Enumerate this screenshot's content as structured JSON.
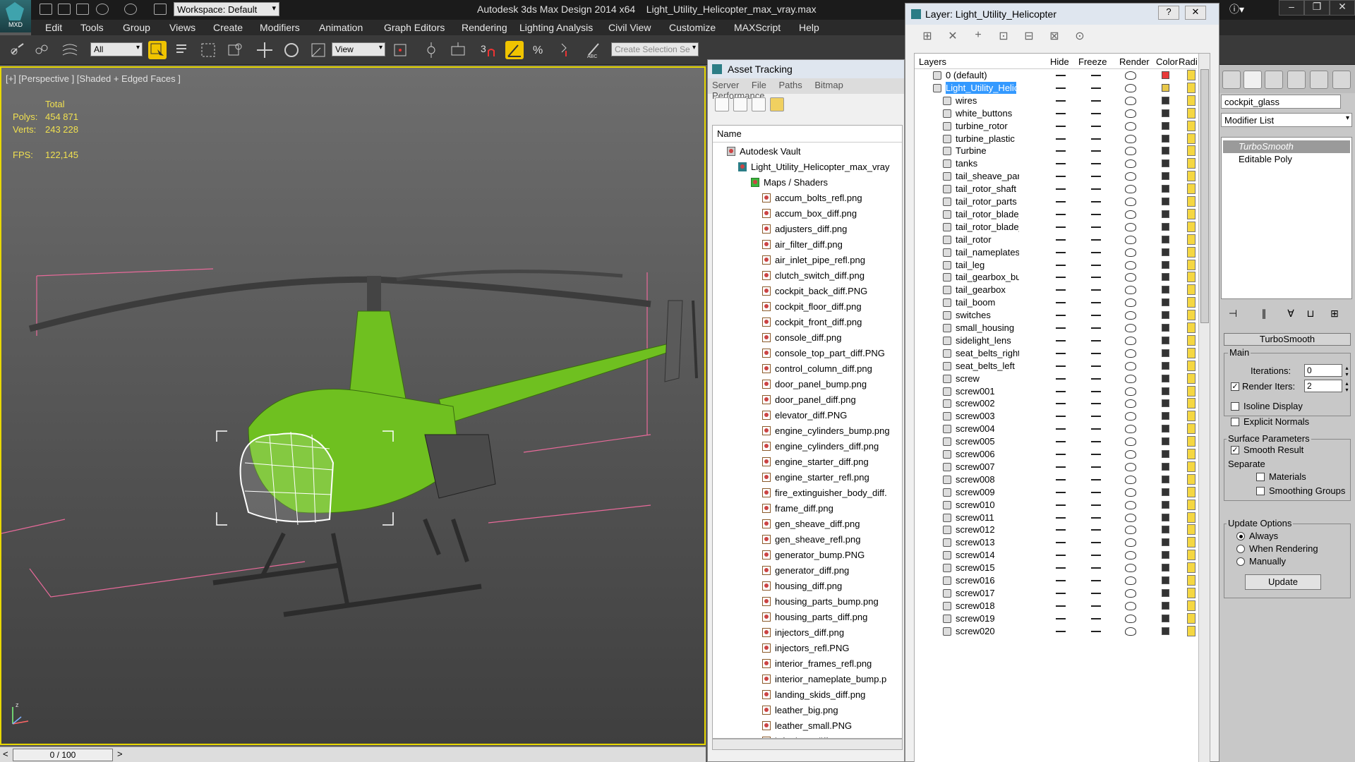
{
  "titlebar": {
    "workspace": "Workspace: Default",
    "app_name": "Autodesk 3ds Max Design 2014 x64",
    "file_name": "Light_Utility_Helicopter_max_vray.max",
    "logo_label": "MXD"
  },
  "menu": [
    "Edit",
    "Tools",
    "Group",
    "Views",
    "Create",
    "Modifiers",
    "Animation",
    "Graph Editors",
    "Rendering",
    "Lighting Analysis",
    "Civil View",
    "Customize",
    "MAXScript",
    "Help"
  ],
  "toolbar": {
    "filter": "All",
    "ref_coord": "View",
    "selection_set_placeholder": "Create Selection Se"
  },
  "viewport": {
    "label": "[+] [Perspective ] [Shaded + Edged Faces ]",
    "total_label": "Total",
    "polys_label": "Polys:",
    "polys_value": "454 871",
    "verts_label": "Verts:",
    "verts_value": "243 228",
    "fps_label": "FPS:",
    "fps_value": "122,145"
  },
  "statusbar": {
    "timeline": "0 / 100"
  },
  "asset_tracking": {
    "title": "Asset Tracking",
    "menu": [
      "Server",
      "File",
      "Paths",
      "Bitmap Performance"
    ],
    "column_name": "Name",
    "vault": "Autodesk Vault",
    "scene_file": "Light_Utility_Helicopter_max_vray",
    "maps_folder": "Maps / Shaders",
    "files": [
      "accum_bolts_refl.png",
      "accum_box_diff.png",
      "adjusters_diff.png",
      "air_filter_diff.png",
      "air_inlet_pipe_refl.png",
      "clutch_switch_diff.png",
      "cockpit_back_diff.PNG",
      "cockpit_floor_diff.png",
      "cockpit_front_diff.png",
      "console_diff.png",
      "console_top_part_diff.PNG",
      "control_column_diff.png",
      "door_panel_bump.png",
      "door_panel_diff.png",
      "elevator_diff.PNG",
      "engine_cylinders_bump.png",
      "engine_cylinders_diff.png",
      "engine_starter_diff.png",
      "engine_starter_refl.png",
      "fire_extinguisher_body_diff.",
      "frame_diff.png",
      "gen_sheave_diff.png",
      "gen_sheave_refl.png",
      "generator_bump.PNG",
      "generator_diff.png",
      "housing_diff.png",
      "housing_parts_bump.png",
      "housing_parts_diff.png",
      "injectors_diff.png",
      "injectors_refl.PNG",
      "interior_frames_refl.png",
      "interior_nameplate_bump.p",
      "landing_skids_diff.png",
      "leather_big.png",
      "leather_small.PNG",
      "left_door_diff.PNG"
    ]
  },
  "layer_window": {
    "title": "Layer: Light_Utility_Helicopter",
    "help_glyph": "?",
    "close_glyph": "✕",
    "columns": {
      "layers": "Layers",
      "hide": "Hide",
      "freeze": "Freeze",
      "render": "Render",
      "color": "Color",
      "radiosity": "Radio"
    },
    "default_layer": "0 (default)",
    "active_layer": "Light_Utility_Helicopter",
    "default_color": "#e83a3a",
    "active_color": "#e8c84a",
    "object_color": "#333333",
    "objects": [
      "wires",
      "white_buttons",
      "turbine_rotor",
      "turbine_plastic",
      "Turbine",
      "tanks",
      "tail_sheave_part",
      "tail_rotor_shaft",
      "tail_rotor_parts",
      "tail_rotor_blade_",
      "tail_rotor_blade_",
      "tail_rotor",
      "tail_nameplates",
      "tail_leg",
      "tail_gearbox_bu",
      "tail_gearbox",
      "tail_boom",
      "switches",
      "small_housing",
      "sidelight_lens",
      "seat_belts_right",
      "seat_belts_left",
      "screw",
      "screw001",
      "screw002",
      "screw003",
      "screw004",
      "screw005",
      "screw006",
      "screw007",
      "screw008",
      "screw009",
      "screw010",
      "screw011",
      "screw012",
      "screw013",
      "screw014",
      "screw015",
      "screw016",
      "screw017",
      "screw018",
      "screw019",
      "screw020"
    ]
  },
  "command_panel": {
    "object_name": "cockpit_glass",
    "modifier_list": "Modifier List",
    "stack": [
      "TurboSmooth",
      "Editable Poly"
    ],
    "rollout_title": "TurboSmooth",
    "main_group": "Main",
    "iterations_label": "Iterations:",
    "iterations_value": "0",
    "render_iters_label": "Render Iters:",
    "render_iters_value": "2",
    "isoline_label": "Isoline Display",
    "explicit_normals_label": "Explicit Normals",
    "surface_group": "Surface Parameters",
    "smooth_result_label": "Smooth Result",
    "separate_label": "Separate",
    "materials_label": "Materials",
    "smoothing_groups_label": "Smoothing Groups",
    "update_group": "Update Options",
    "always_label": "Always",
    "when_rendering_label": "When Rendering",
    "manually_label": "Manually",
    "update_button": "Update"
  }
}
